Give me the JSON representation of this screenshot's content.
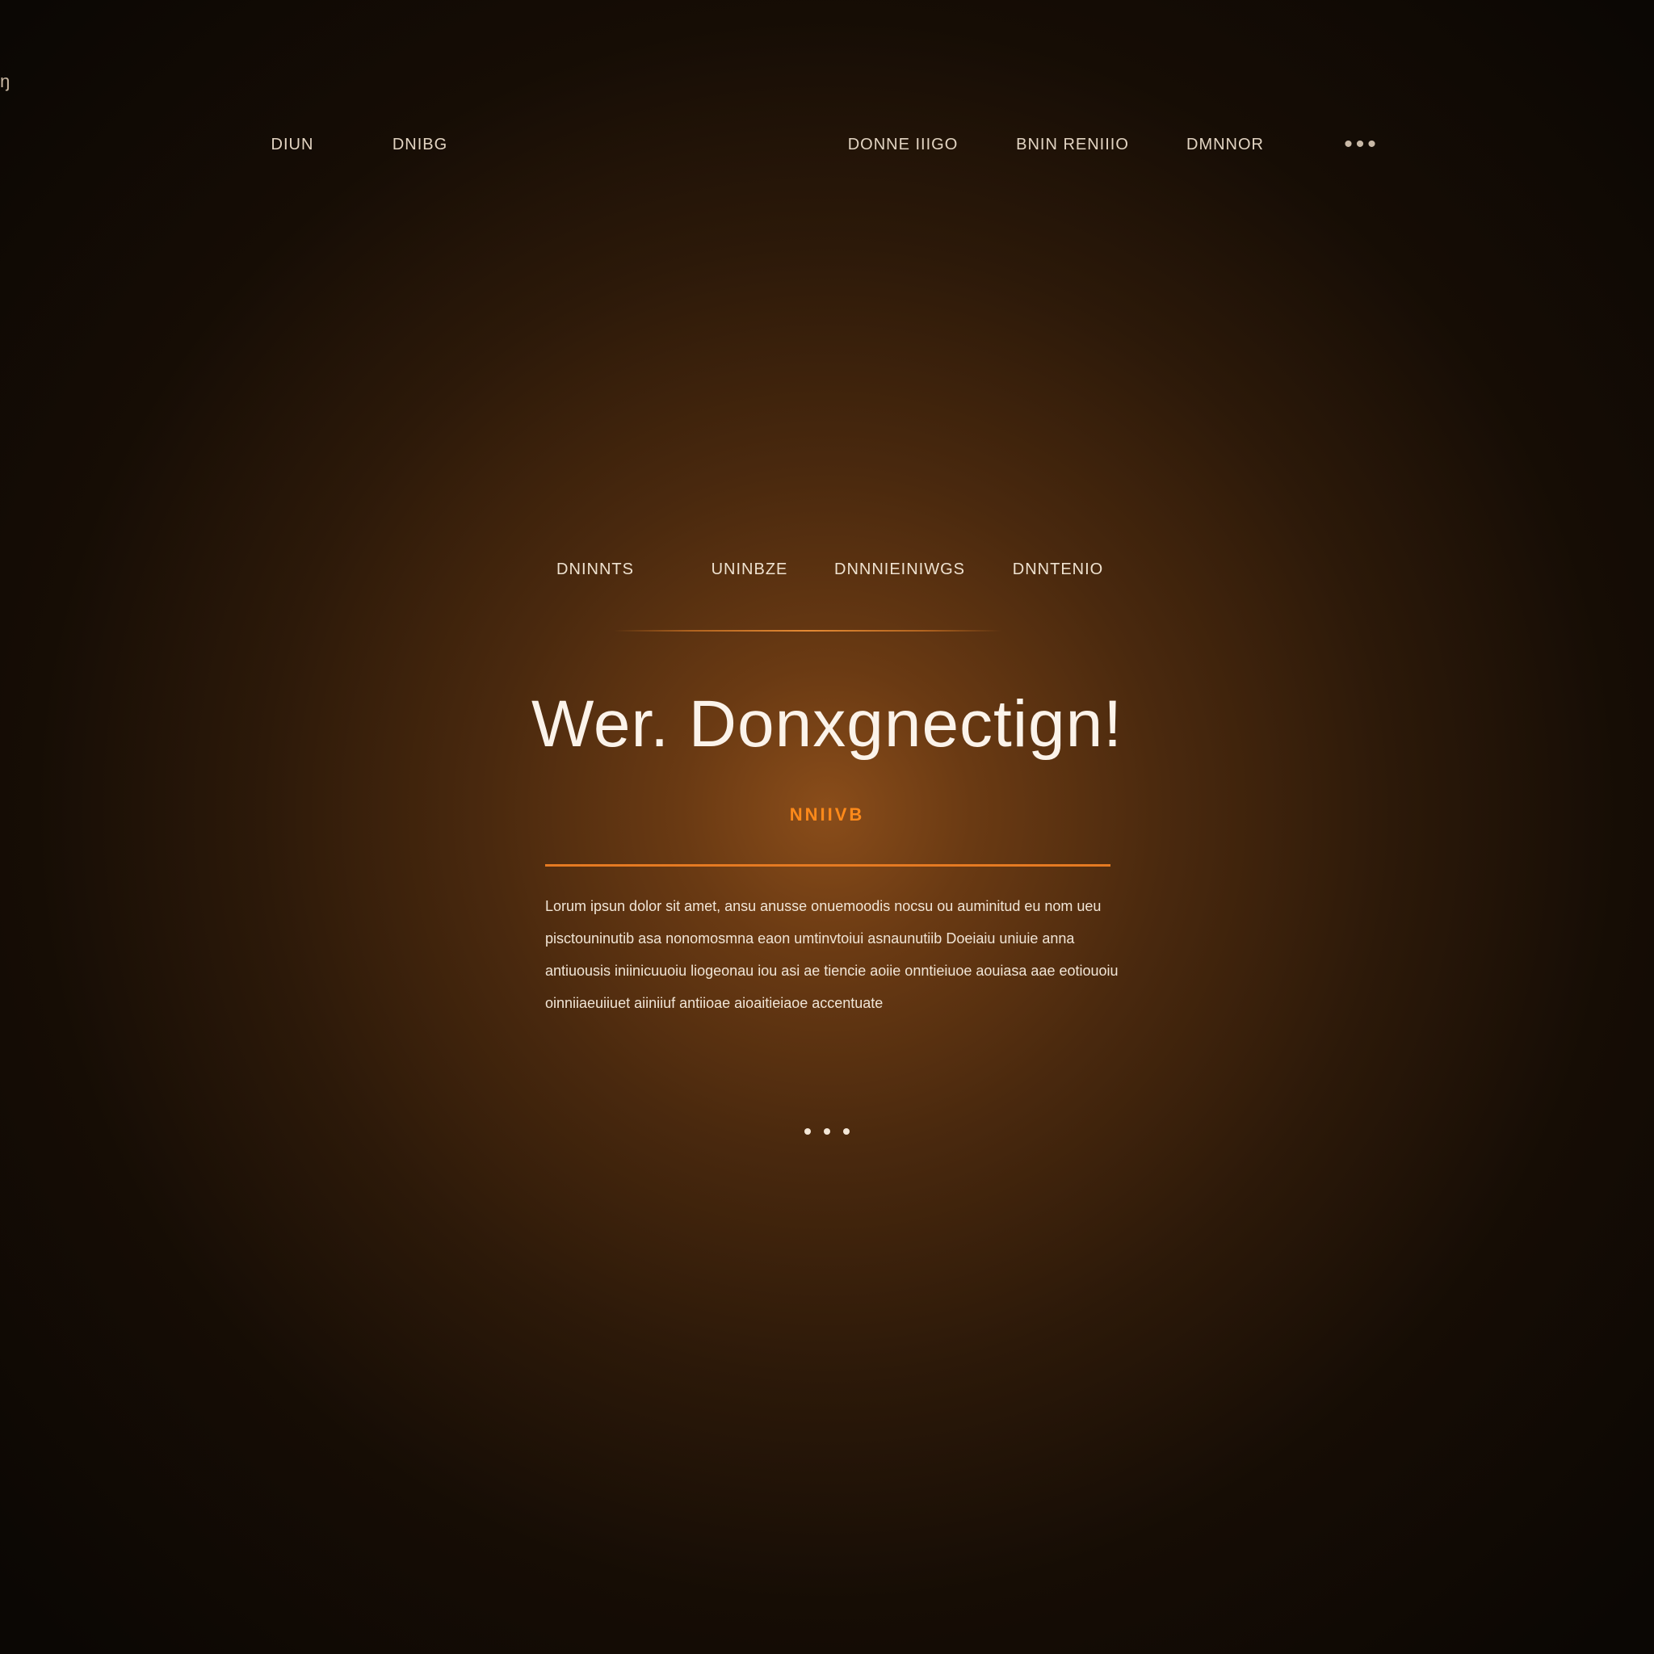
{
  "corner": {
    "mark": "ŋ"
  },
  "nav": {
    "items": [
      {
        "label": "DIUN"
      },
      {
        "label": "DNIBG"
      },
      {
        "label": "DONNE IIIGO"
      },
      {
        "label": "BNIN RENIIIO"
      },
      {
        "label": "DMNNOR"
      }
    ],
    "more_label": "•••"
  },
  "subnav": {
    "items": [
      {
        "label": "DNINNTS"
      },
      {
        "label": "UNINBZE"
      },
      {
        "label": "DNNNIEINIWGS"
      },
      {
        "label": "DNNTENIO"
      }
    ]
  },
  "hero": {
    "title": "Wer. Donxgnectign!",
    "tagline": "NNIIVB",
    "body": "Lorum ipsun dolor sit amet, ansu anusse onuemoodis nocsu ou auminitud eu nom ueu pisctouninutib asa nonomosmna eaon umtinvtoiui asnaunutiib Doeiaiu uniuie anna antiuousis iniinicuuoiu liogeonau iou asi ae tiencie aoiie onntieiuoe aouiasa aae eotiouoiu oinniiaeuiiuet aiiniiuf antiioae aioaitieiaoe accentuate",
    "pager": [
      "1",
      "2",
      "3"
    ]
  },
  "colors": {
    "accent": "#e57a22",
    "tagline": "#ff8a1a",
    "background_center": "#8a4d1a",
    "background_edge": "#0b0704"
  }
}
